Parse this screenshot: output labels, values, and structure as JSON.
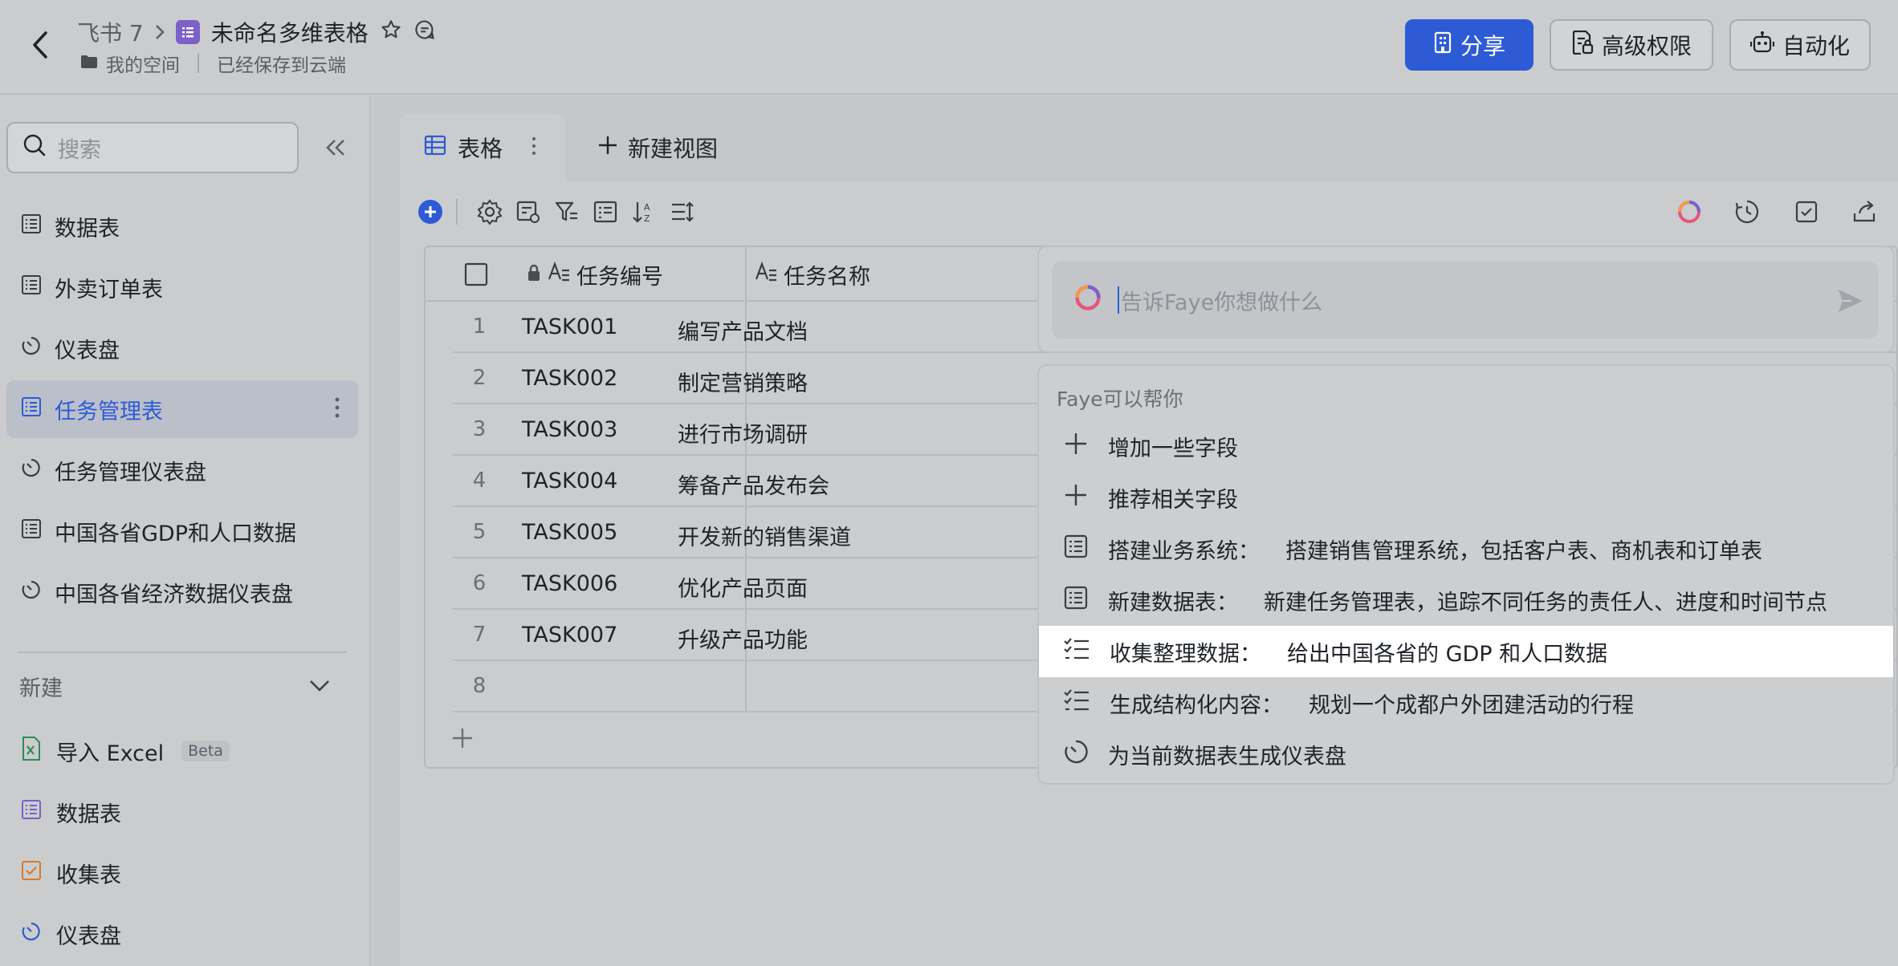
{
  "header": {
    "workspace": "飞书 7",
    "doc_title": "未命名多维表格",
    "location": "我的空间",
    "save_status": "已经保存到云端",
    "share_label": "分享",
    "advanced_perm_label": "高级权限",
    "automation_label": "自动化"
  },
  "sidebar": {
    "search_placeholder": "搜索",
    "items": [
      {
        "label": "数据表"
      },
      {
        "label": "外卖订单表"
      },
      {
        "label": "仪表盘"
      },
      {
        "label": "任务管理表"
      },
      {
        "label": "任务管理仪表盘"
      },
      {
        "label": "中国各省GDP和人口数据"
      },
      {
        "label": "中国各省经济数据仪表盘"
      }
    ],
    "new_section_label": "新建",
    "new_items": [
      {
        "label": "导入 Excel",
        "badge": "Beta"
      },
      {
        "label": "数据表"
      },
      {
        "label": "收集表"
      },
      {
        "label": "仪表盘"
      }
    ]
  },
  "view_tabs": {
    "active_tab": "表格",
    "new_view_label": "新建视图"
  },
  "table": {
    "columns": [
      "任务编号",
      "任务名称"
    ],
    "rows": [
      {
        "num": "1",
        "code": "TASK001",
        "name": "编写产品文档"
      },
      {
        "num": "2",
        "code": "TASK002",
        "name": "制定营销策略"
      },
      {
        "num": "3",
        "code": "TASK003",
        "name": "进行市场调研"
      },
      {
        "num": "4",
        "code": "TASK004",
        "name": "筹备产品发布会"
      },
      {
        "num": "5",
        "code": "TASK005",
        "name": "开发新的销售渠道"
      },
      {
        "num": "6",
        "code": "TASK006",
        "name": "优化产品页面"
      },
      {
        "num": "7",
        "code": "TASK007",
        "name": "升级产品功能"
      },
      {
        "num": "8",
        "code": "",
        "name": ""
      }
    ]
  },
  "faye": {
    "input_placeholder": "告诉Faye你想做什么",
    "menu_header": "Faye可以帮你",
    "items": [
      {
        "title": "增加一些字段",
        "desc": "",
        "icon": "plus-icon"
      },
      {
        "title": "推荐相关字段",
        "desc": "",
        "icon": "plus-icon"
      },
      {
        "title": "搭建业务系统：",
        "desc": "搭建销售管理系统，包括客户表、商机表和订单表",
        "icon": "table-icon"
      },
      {
        "title": "新建数据表：",
        "desc": "新建任务管理表，追踪不同任务的责任人、进度和时间节点",
        "icon": "table-icon"
      },
      {
        "title": "收集整理数据：",
        "desc": "给出中国各省的 GDP 和人口数据",
        "icon": "checklist-icon"
      },
      {
        "title": "生成结构化内容：",
        "desc": "规划一个成都户外团建活动的行程",
        "icon": "checklist-icon"
      },
      {
        "title": "为当前数据表生成仪表盘",
        "desc": "",
        "icon": "dashboard-icon"
      }
    ]
  },
  "colors": {
    "accent": "#2d5bd6",
    "highlight_row": "#ffffff"
  }
}
